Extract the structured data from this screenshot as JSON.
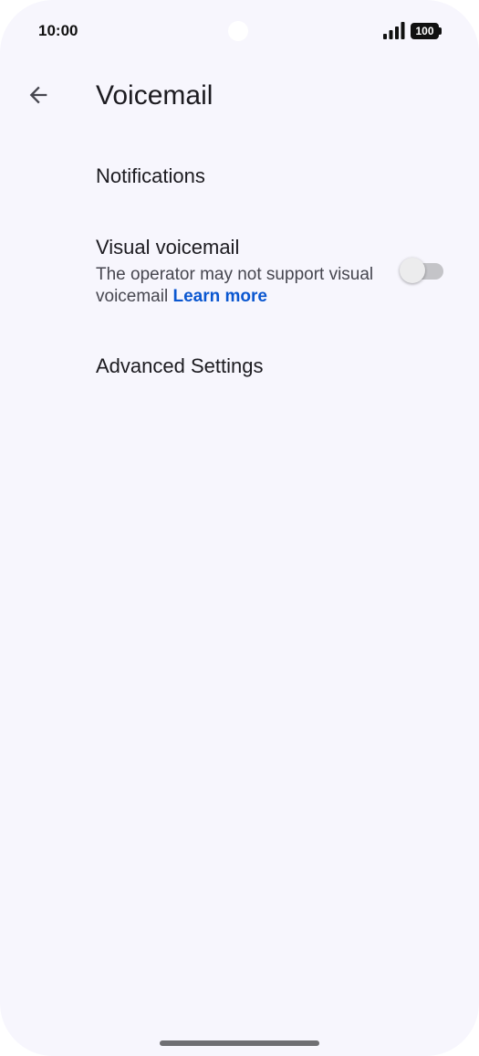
{
  "status_bar": {
    "time": "10:00",
    "battery": "100"
  },
  "header": {
    "title": "Voicemail",
    "back_icon": "arrow-back-icon"
  },
  "settings": {
    "notifications": {
      "title": "Notifications"
    },
    "visual_voicemail": {
      "title": "Visual voicemail",
      "subtitle": "The operator may not support visual voicemail",
      "link": "Learn more",
      "enabled": false
    },
    "advanced": {
      "title": "Advanced Settings"
    }
  },
  "colors": {
    "background": "#f7f6fd",
    "link": "#0b57d0",
    "toggle_off_track": "#c4c4c8"
  }
}
